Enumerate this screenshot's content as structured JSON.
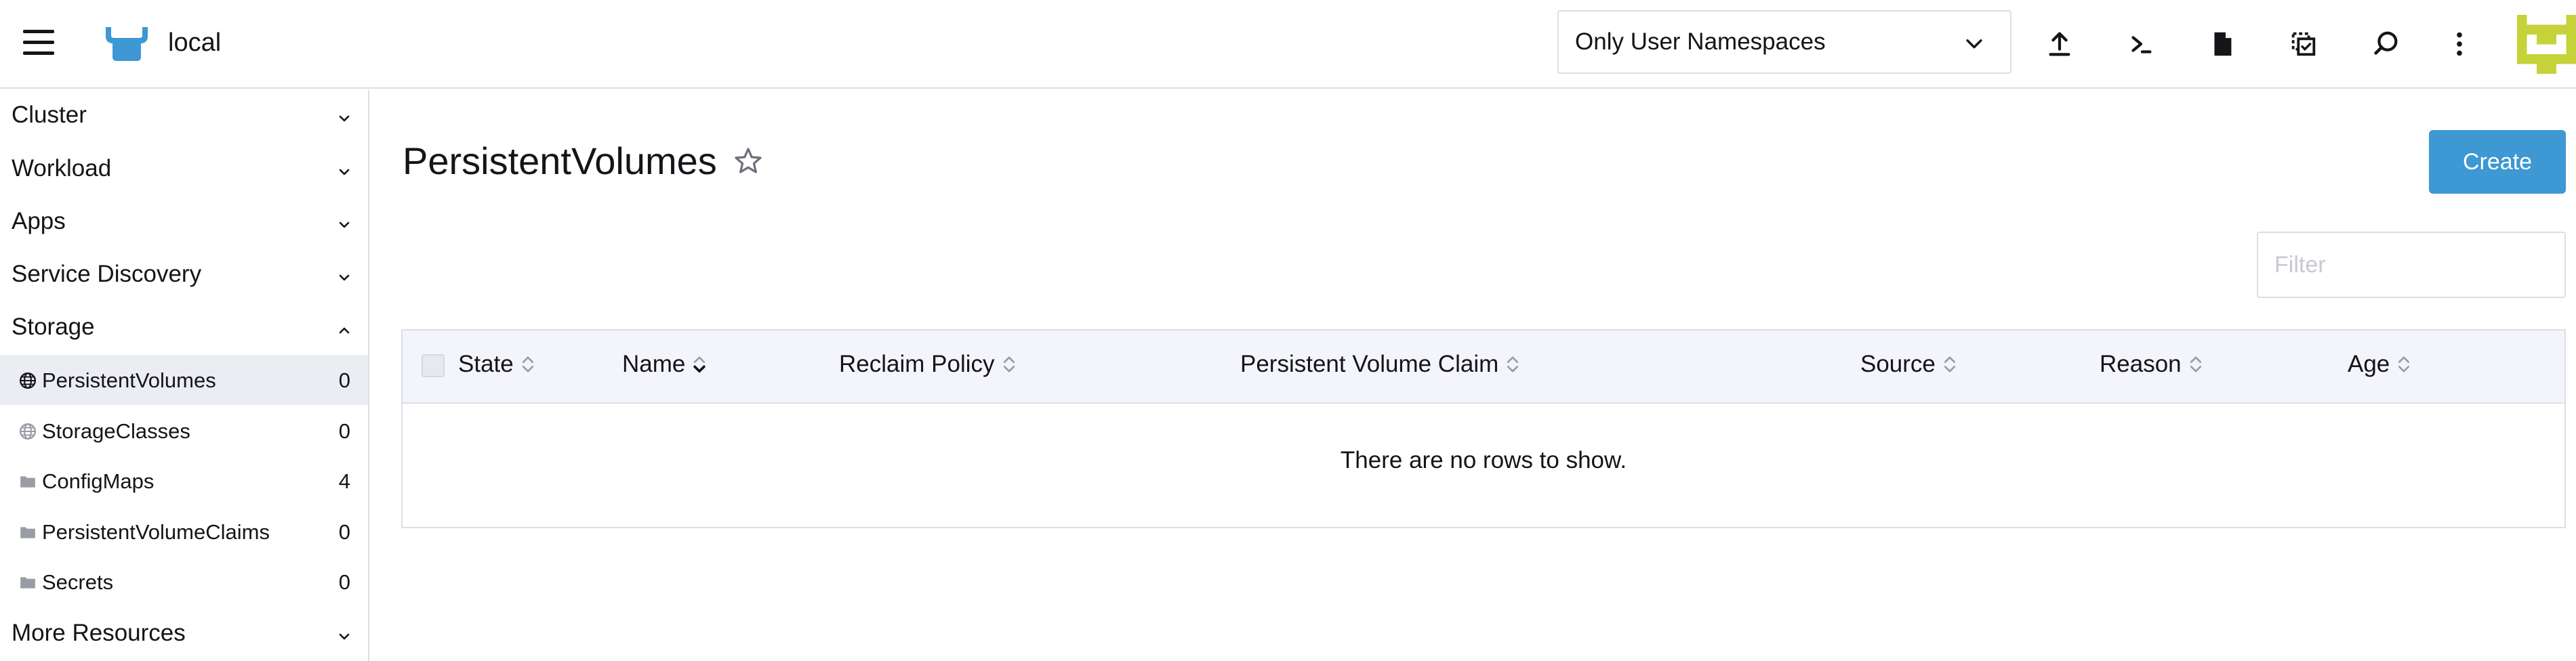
{
  "header": {
    "cluster_name": "local",
    "namespace_filter": "Only User Namespaces",
    "actions": [
      {
        "name": "import-yaml-icon"
      },
      {
        "name": "kubectl-shell-icon"
      },
      {
        "name": "kubeconfig-download-icon"
      },
      {
        "name": "copy-kubeconfig-icon"
      },
      {
        "name": "search-icon"
      },
      {
        "name": "more-actions-icon"
      }
    ]
  },
  "sidebar": {
    "groups": [
      {
        "label": "Cluster",
        "expanded": false
      },
      {
        "label": "Workload",
        "expanded": false
      },
      {
        "label": "Apps",
        "expanded": false
      },
      {
        "label": "Service Discovery",
        "expanded": false
      },
      {
        "label": "Storage",
        "expanded": true
      },
      {
        "label": "More Resources",
        "expanded": false
      }
    ],
    "storage_items": [
      {
        "label": "PersistentVolumes",
        "count": "0",
        "icon": "globe-icon",
        "active": true
      },
      {
        "label": "StorageClasses",
        "count": "0",
        "icon": "globe-icon",
        "active": false
      },
      {
        "label": "ConfigMaps",
        "count": "4",
        "icon": "folder-icon",
        "active": false
      },
      {
        "label": "PersistentVolumeClaims",
        "count": "0",
        "icon": "folder-icon",
        "active": false
      },
      {
        "label": "Secrets",
        "count": "0",
        "icon": "folder-icon",
        "active": false
      }
    ]
  },
  "main": {
    "title": "PersistentVolumes",
    "create_label": "Create",
    "filter_placeholder": "Filter",
    "table": {
      "columns": [
        "State",
        "Name",
        "Reclaim Policy",
        "Persistent Volume Claim",
        "Source",
        "Reason",
        "Age"
      ],
      "empty_message": "There are no rows to show."
    }
  },
  "colors": {
    "primary": "#3d98d3",
    "logo": "#3d98d3",
    "active_row": "#ebedf2",
    "table_header": "#f4f5fa",
    "avatar": "#c5d23a",
    "border": "#dcdee7"
  }
}
